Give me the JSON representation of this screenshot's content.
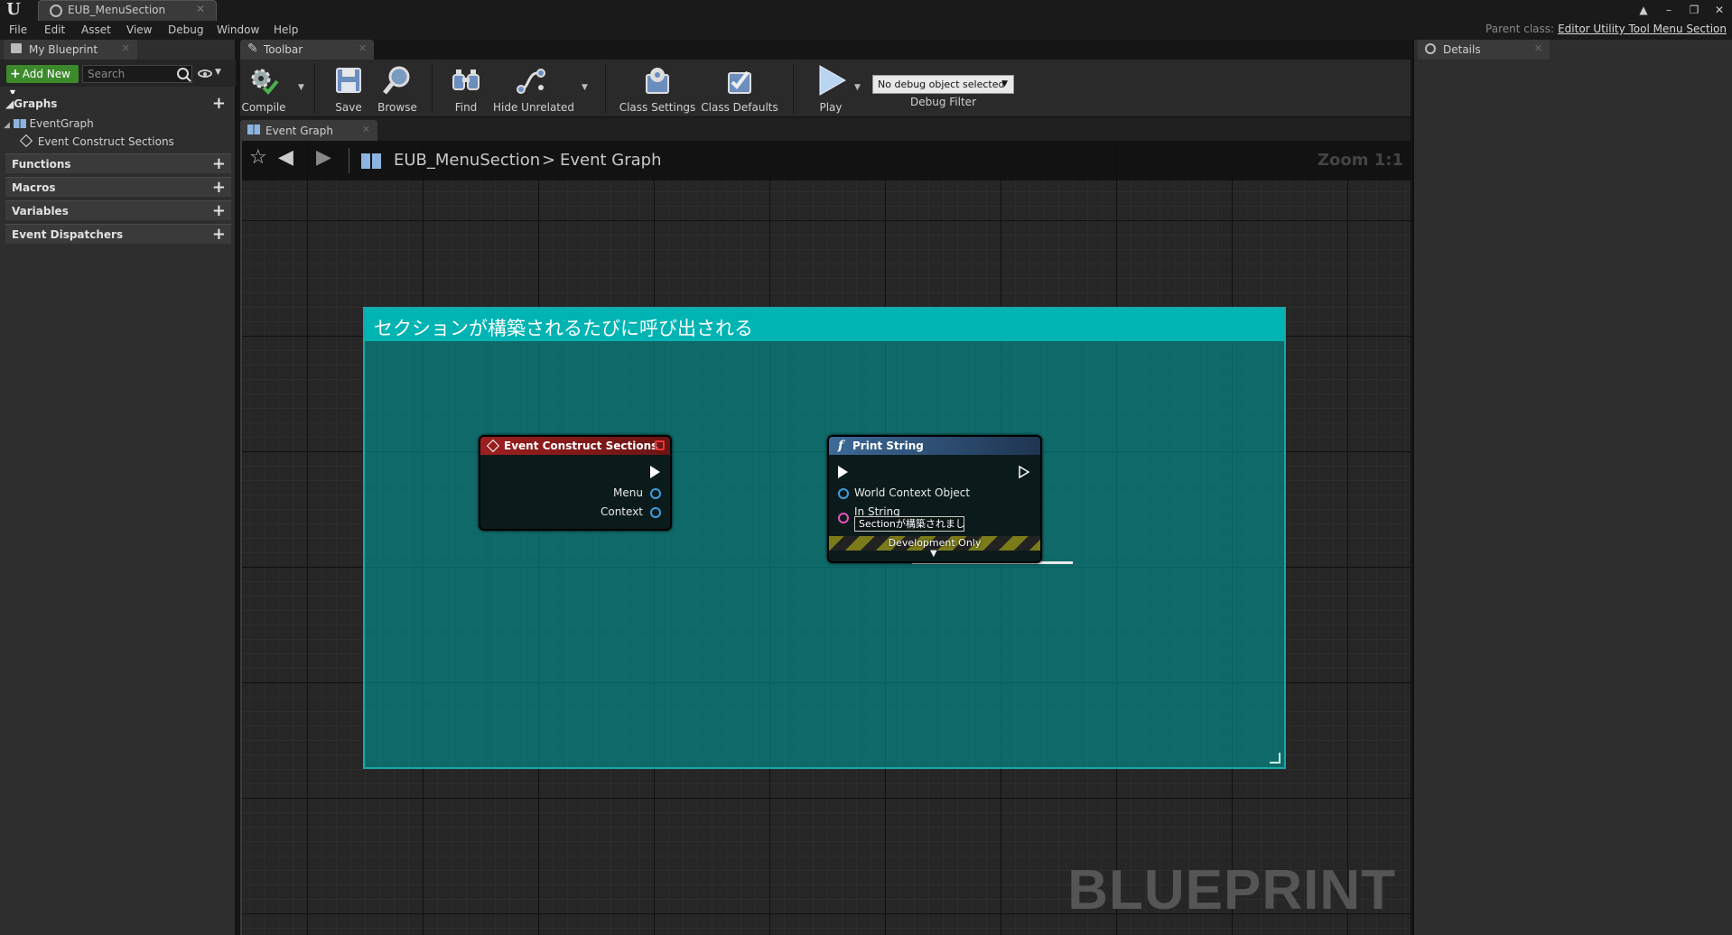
{
  "window": {
    "tab_title": "EUB_MenuSection",
    "controls": [
      "▲",
      "–",
      "❐",
      "✕"
    ]
  },
  "menu": [
    "File",
    "Edit",
    "Asset",
    "View",
    "Debug",
    "Window",
    "Help"
  ],
  "parent_class": {
    "label": "Parent class:",
    "value": "Editor Utility Tool Menu Section"
  },
  "my_blueprint": {
    "tab_label": "My Blueprint",
    "add_new_label": "Add New",
    "search_placeholder": "Search",
    "categories": {
      "graphs": "Graphs",
      "functions": "Functions",
      "macros": "Macros",
      "variables": "Variables",
      "event_dispatchers": "Event Dispatchers"
    },
    "tree": {
      "event_graph": "EventGraph",
      "event_item": "Event Construct Sections"
    }
  },
  "toolbar": {
    "tab_label": "Toolbar",
    "compile": "Compile",
    "save": "Save",
    "browse": "Browse",
    "find": "Find",
    "hide_unrelated": "Hide Unrelated",
    "class_settings": "Class Settings",
    "class_defaults": "Class Defaults",
    "play": "Play",
    "debug_select": "No debug object selected",
    "debug_filter": "Debug Filter"
  },
  "graph": {
    "tab_label": "Event Graph",
    "breadcrumb": [
      "EUB_MenuSection",
      "Event Graph"
    ],
    "breadcrumb_sep": ">",
    "zoom": "Zoom 1:1",
    "watermark": "BLUEPRINT",
    "comment": "セクションが構築されるたびに呼び出される",
    "event_node": {
      "title": "Event Construct Sections",
      "pins": [
        "Menu",
        "Context"
      ]
    },
    "print_node": {
      "title": "Print String",
      "function_glyph": "f",
      "world_context": "World Context Object",
      "in_string": "In String",
      "in_string_value": "Sectionが構築されました",
      "dev_only": "Development Only"
    }
  },
  "details": {
    "tab_label": "Details"
  },
  "colors": {
    "comment": "#00b4b4",
    "event_header": "#8a1a1a",
    "function_header": "#2b4a6b",
    "add_new": "#3c8a2c",
    "object_pin": "#3a9ede",
    "string_pin": "#e94fbf"
  }
}
